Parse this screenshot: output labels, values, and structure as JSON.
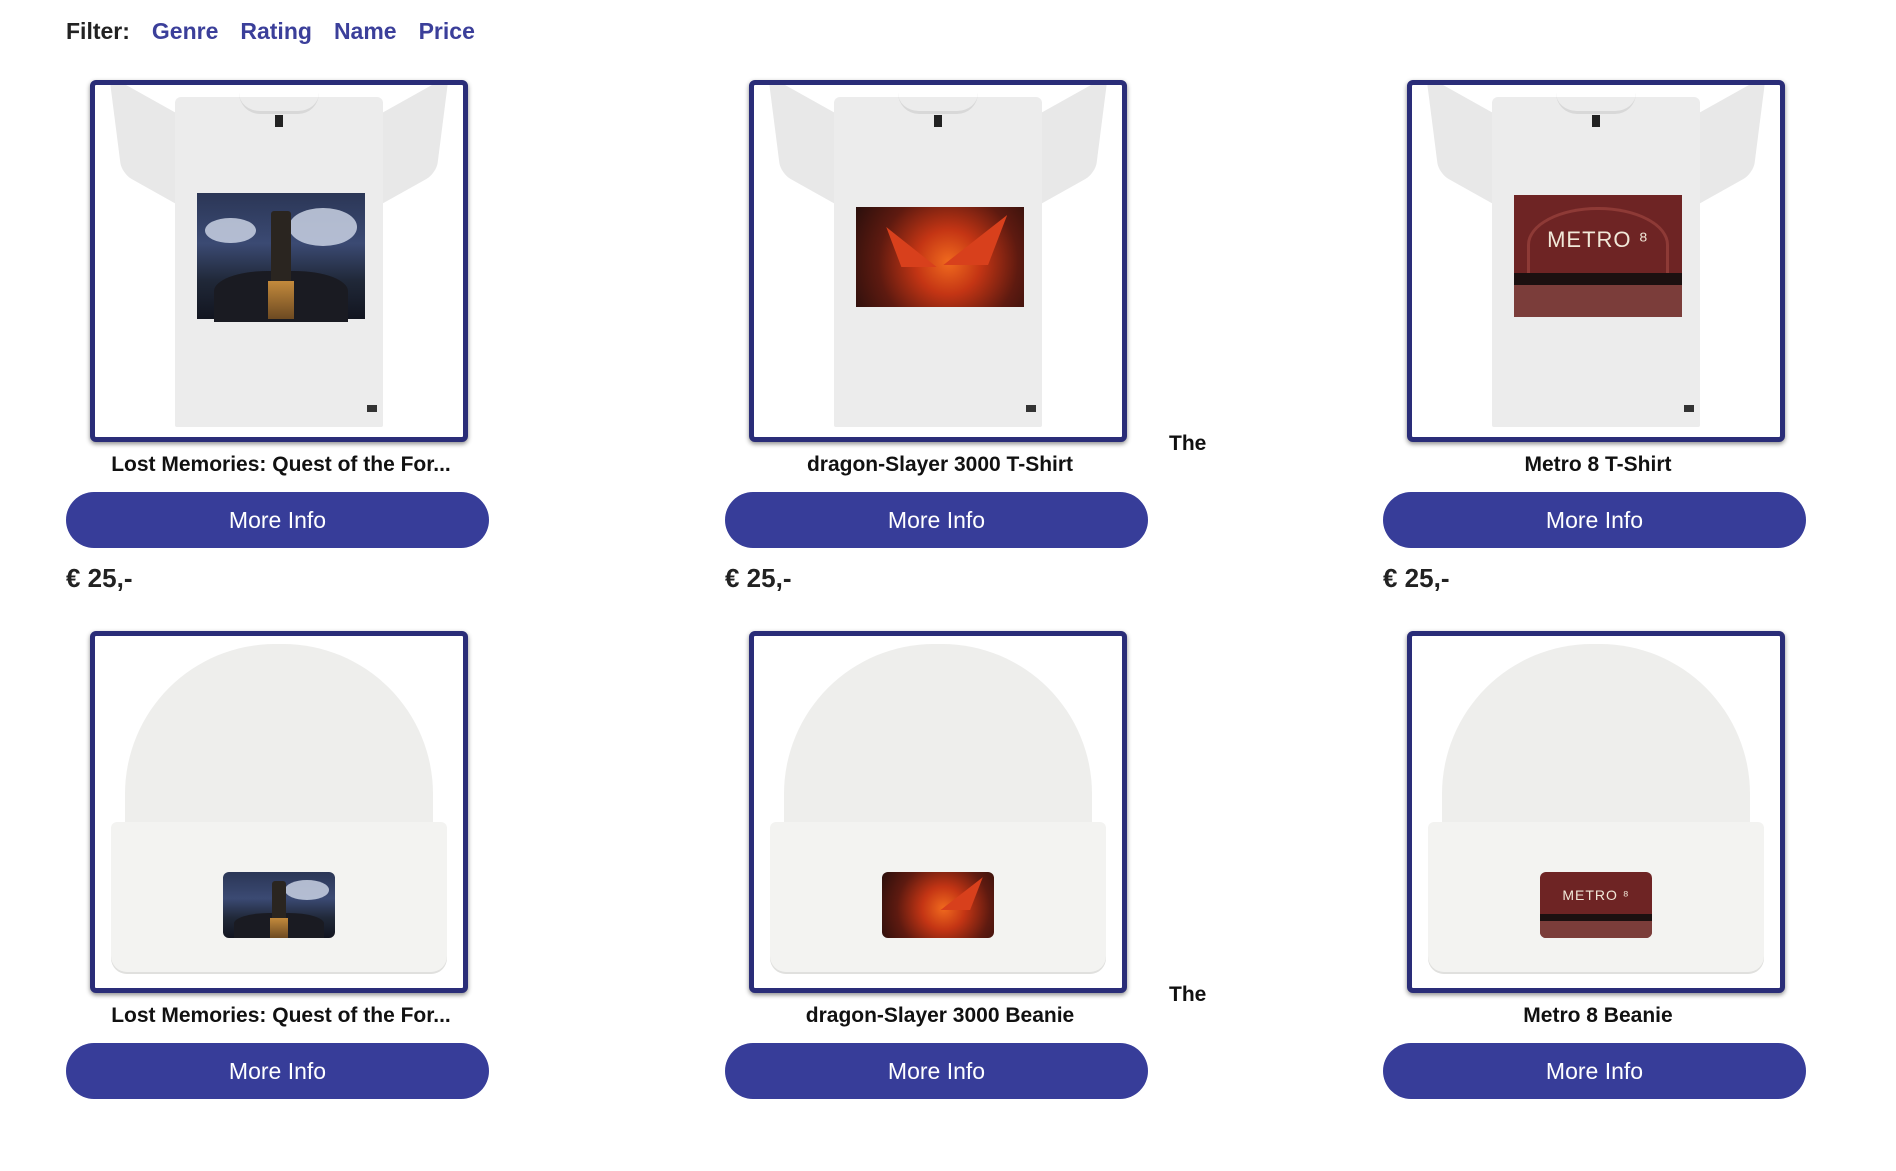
{
  "filter": {
    "label": "Filter:",
    "links": [
      "Genre",
      "Rating",
      "Name",
      "Price"
    ]
  },
  "products": [
    {
      "title": "Lost Memories: Quest of the For...",
      "prefix": "",
      "button": "More Info",
      "price": "€ 25,-",
      "type": "tshirt",
      "art": "tower"
    },
    {
      "title": "dragon-Slayer 3000 T-Shirt",
      "prefix": "The",
      "button": "More Info",
      "price": "€ 25,-",
      "type": "tshirt",
      "art": "dragon"
    },
    {
      "title": "Metro 8 T-Shirt",
      "prefix": "",
      "button": "More Info",
      "price": "€ 25,-",
      "type": "tshirt",
      "art": "metro"
    },
    {
      "title": "Lost Memories: Quest of the For...",
      "prefix": "",
      "button": "More Info",
      "price": "",
      "type": "beanie",
      "art": "tower"
    },
    {
      "title": "dragon-Slayer 3000 Beanie",
      "prefix": "The",
      "button": "More Info",
      "price": "",
      "type": "beanie",
      "art": "dragon"
    },
    {
      "title": "Metro 8 Beanie",
      "prefix": "",
      "button": "More Info",
      "price": "",
      "type": "beanie",
      "art": "metro"
    }
  ],
  "art_text": {
    "metro_logo": "METRO ⁸"
  },
  "colors": {
    "accent": "#373d99",
    "link": "#3b3f9a",
    "frame": "#2a2d78"
  }
}
